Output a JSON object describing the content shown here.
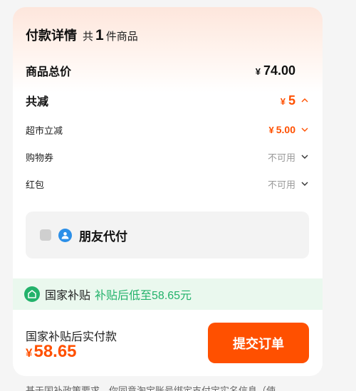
{
  "header": {
    "title": "付款详情",
    "count_prefix": "共",
    "count": "1",
    "count_suffix": "件商品"
  },
  "total": {
    "label": "商品总价",
    "currency": "¥",
    "value": "74.00"
  },
  "discount": {
    "label": "共减",
    "currency": "¥",
    "value": "5",
    "expanded": true
  },
  "supermarket_discount": {
    "label": "超市立减",
    "currency": "¥",
    "value": "5.00"
  },
  "voucher": {
    "label": "购物券",
    "status": "不可用"
  },
  "red_packet": {
    "label": "红包",
    "status": "不可用"
  },
  "friend_pay": {
    "label": "朋友代付",
    "checked": false
  },
  "subsidy": {
    "name": "国家补贴",
    "note": "补贴后低至58.65元"
  },
  "footer": {
    "label": "国家补贴后实付款",
    "currency": "¥",
    "price": "58.65",
    "submit_label": "提交订单"
  },
  "bottom_note": "基于国补政策要求，你同意淘宝账号绑定支付宝实名信息（使",
  "colors": {
    "accent": "#ff5000",
    "subsidy_green": "#23b26b",
    "friend_blue": "#2b8fe8"
  },
  "icons": {
    "chevron_up": "chevron-up-icon",
    "chevron_down": "chevron-down-icon",
    "friend_pay": "friend-pay-icon",
    "subsidy": "subsidy-icon"
  }
}
